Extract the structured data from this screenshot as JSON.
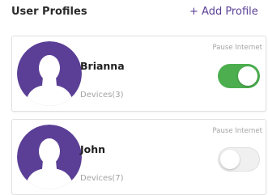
{
  "header": {
    "title": "User Profiles",
    "add_profile_label": "+ Add Profile"
  },
  "profiles": [
    {
      "name": "Brianna",
      "devices_label": "Devices(3)",
      "pause_label": "Pause Internet",
      "pause_enabled": true
    },
    {
      "name": "John",
      "devices_label": "Devices(7)",
      "pause_label": "Pause Internet",
      "pause_enabled": false
    }
  ],
  "colors": {
    "accent": "#5b3f96",
    "avatar_background": "#5b3f96",
    "avatar_silhouette": "#ffffff",
    "toggle_on": "#4cae4f",
    "toggle_off": "#f0f0f0"
  },
  "icons": {
    "avatar": "user-silhouette-icon"
  }
}
